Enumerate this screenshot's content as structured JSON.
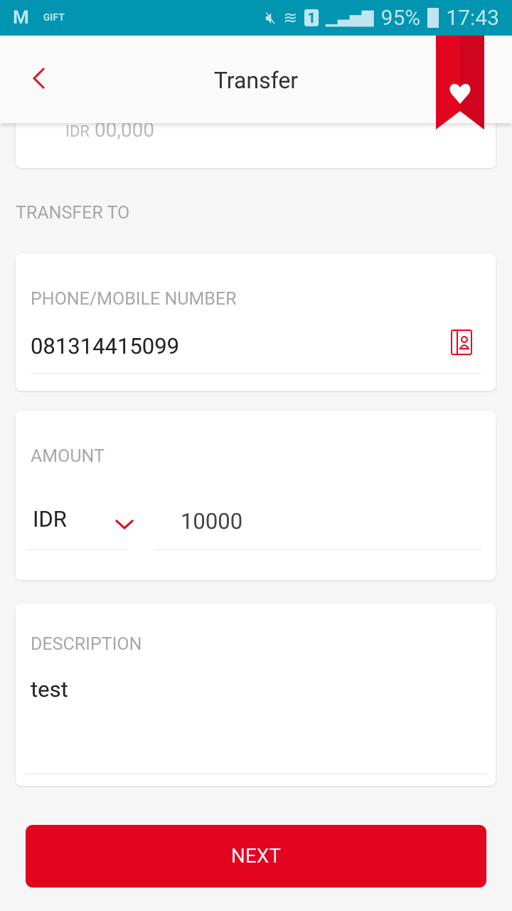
{
  "status_bar": {
    "gift_label": "GIFT",
    "sim": "1",
    "battery": "95%",
    "time": "17:43"
  },
  "header": {
    "title": "Transfer"
  },
  "previous_card": {
    "currency": "IDR",
    "amount": "00,000"
  },
  "section_title": "TRANSFER TO",
  "phone": {
    "label": "PHONE/MOBILE NUMBER",
    "value": "081314415099"
  },
  "amount": {
    "label": "AMOUNT",
    "currency": "IDR",
    "value": "10000"
  },
  "description": {
    "label": "DESCRIPTION",
    "value": "test"
  },
  "next_label": "NEXT",
  "colors": {
    "accent": "#e30520",
    "status_bar": "#0295b1"
  }
}
